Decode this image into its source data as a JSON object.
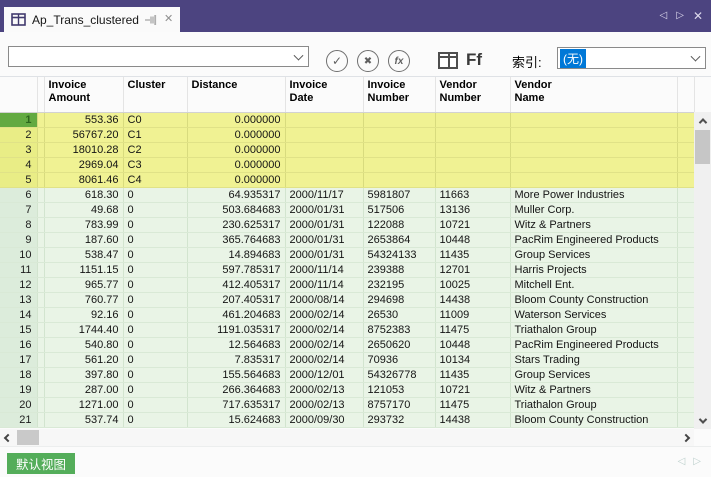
{
  "window": {
    "tab_title": "Ap_Trans_clustered",
    "nav_back": "◁",
    "nav_forward": "▷",
    "close": "✕"
  },
  "toolbar": {
    "filter_value": "",
    "apply_glyph": "✓",
    "cancel_glyph": "✖",
    "fx_glyph": "fx",
    "font_button": "Ff",
    "index_label": "索引:",
    "index_selected": "(无)"
  },
  "table": {
    "columns": [
      {
        "id": "invoice_amount",
        "lines": [
          "Invoice",
          "Amount"
        ],
        "align": "right"
      },
      {
        "id": "cluster",
        "lines": [
          "Cluster"
        ],
        "align": "left"
      },
      {
        "id": "distance",
        "lines": [
          "Distance"
        ],
        "align": "right"
      },
      {
        "id": "invoice_date",
        "lines": [
          "Invoice",
          "Date"
        ],
        "align": "left"
      },
      {
        "id": "invoice_number",
        "lines": [
          "Invoice",
          "Number"
        ],
        "align": "left"
      },
      {
        "id": "vendor_number",
        "lines": [
          "Vendor",
          "Number"
        ],
        "align": "left"
      },
      {
        "id": "vendor_name",
        "lines": [
          "Vendor",
          "Name"
        ],
        "align": "left"
      }
    ],
    "rows": [
      {
        "num": 1,
        "highlight": true,
        "cells": {
          "invoice_amount": "553.36",
          "cluster": "C0",
          "distance": "0.000000",
          "invoice_date": "",
          "invoice_number": "",
          "vendor_number": "",
          "vendor_name": ""
        }
      },
      {
        "num": 2,
        "highlight": true,
        "cells": {
          "invoice_amount": "56767.20",
          "cluster": "C1",
          "distance": "0.000000",
          "invoice_date": "",
          "invoice_number": "",
          "vendor_number": "",
          "vendor_name": ""
        }
      },
      {
        "num": 3,
        "highlight": true,
        "cells": {
          "invoice_amount": "18010.28",
          "cluster": "C2",
          "distance": "0.000000",
          "invoice_date": "",
          "invoice_number": "",
          "vendor_number": "",
          "vendor_name": ""
        }
      },
      {
        "num": 4,
        "highlight": true,
        "cells": {
          "invoice_amount": "2969.04",
          "cluster": "C3",
          "distance": "0.000000",
          "invoice_date": "",
          "invoice_number": "",
          "vendor_number": "",
          "vendor_name": ""
        }
      },
      {
        "num": 5,
        "highlight": true,
        "cells": {
          "invoice_amount": "8061.46",
          "cluster": "C4",
          "distance": "0.000000",
          "invoice_date": "",
          "invoice_number": "",
          "vendor_number": "",
          "vendor_name": ""
        }
      },
      {
        "num": 6,
        "highlight": false,
        "cells": {
          "invoice_amount": "618.30",
          "cluster": "0",
          "distance": "64.935317",
          "invoice_date": "2000/11/17",
          "invoice_number": "5981807",
          "vendor_number": "11663",
          "vendor_name": "More Power Industries"
        }
      },
      {
        "num": 7,
        "highlight": false,
        "cells": {
          "invoice_amount": "49.68",
          "cluster": "0",
          "distance": "503.684683",
          "invoice_date": "2000/01/31",
          "invoice_number": "517506",
          "vendor_number": "13136",
          "vendor_name": "Muller Corp."
        }
      },
      {
        "num": 8,
        "highlight": false,
        "cells": {
          "invoice_amount": "783.99",
          "cluster": "0",
          "distance": "230.625317",
          "invoice_date": "2000/01/31",
          "invoice_number": "122088",
          "vendor_number": "10721",
          "vendor_name": "Witz & Partners"
        }
      },
      {
        "num": 9,
        "highlight": false,
        "cells": {
          "invoice_amount": "187.60",
          "cluster": "0",
          "distance": "365.764683",
          "invoice_date": "2000/01/31",
          "invoice_number": "2653864",
          "vendor_number": "10448",
          "vendor_name": "PacRim Engineered Products"
        }
      },
      {
        "num": 10,
        "highlight": false,
        "cells": {
          "invoice_amount": "538.47",
          "cluster": "0",
          "distance": "14.894683",
          "invoice_date": "2000/01/31",
          "invoice_number": "54324133",
          "vendor_number": "11435",
          "vendor_name": "Group Services"
        }
      },
      {
        "num": 11,
        "highlight": false,
        "cells": {
          "invoice_amount": "1151.15",
          "cluster": "0",
          "distance": "597.785317",
          "invoice_date": "2000/11/14",
          "invoice_number": "239388",
          "vendor_number": "12701",
          "vendor_name": "Harris Projects"
        }
      },
      {
        "num": 12,
        "highlight": false,
        "cells": {
          "invoice_amount": "965.77",
          "cluster": "0",
          "distance": "412.405317",
          "invoice_date": "2000/11/14",
          "invoice_number": "232195",
          "vendor_number": "10025",
          "vendor_name": "Mitchell Ent."
        }
      },
      {
        "num": 13,
        "highlight": false,
        "cells": {
          "invoice_amount": "760.77",
          "cluster": "0",
          "distance": "207.405317",
          "invoice_date": "2000/08/14",
          "invoice_number": "294698",
          "vendor_number": "14438",
          "vendor_name": "Bloom County Construction"
        }
      },
      {
        "num": 14,
        "highlight": false,
        "cells": {
          "invoice_amount": "92.16",
          "cluster": "0",
          "distance": "461.204683",
          "invoice_date": "2000/02/14",
          "invoice_number": "26530",
          "vendor_number": "11009",
          "vendor_name": "Waterson Services"
        }
      },
      {
        "num": 15,
        "highlight": false,
        "cells": {
          "invoice_amount": "1744.40",
          "cluster": "0",
          "distance": "1191.035317",
          "invoice_date": "2000/02/14",
          "invoice_number": "8752383",
          "vendor_number": "11475",
          "vendor_name": "Triathalon Group"
        }
      },
      {
        "num": 16,
        "highlight": false,
        "cells": {
          "invoice_amount": "540.80",
          "cluster": "0",
          "distance": "12.564683",
          "invoice_date": "2000/02/14",
          "invoice_number": "2650620",
          "vendor_number": "10448",
          "vendor_name": "PacRim Engineered Products"
        }
      },
      {
        "num": 17,
        "highlight": false,
        "cells": {
          "invoice_amount": "561.20",
          "cluster": "0",
          "distance": "7.835317",
          "invoice_date": "2000/02/14",
          "invoice_number": "70936",
          "vendor_number": "10134",
          "vendor_name": "Stars Trading"
        }
      },
      {
        "num": 18,
        "highlight": false,
        "cells": {
          "invoice_amount": "397.80",
          "cluster": "0",
          "distance": "155.564683",
          "invoice_date": "2000/12/01",
          "invoice_number": "54326778",
          "vendor_number": "11435",
          "vendor_name": "Group Services"
        }
      },
      {
        "num": 19,
        "highlight": false,
        "cells": {
          "invoice_amount": "287.00",
          "cluster": "0",
          "distance": "266.364683",
          "invoice_date": "2000/02/13",
          "invoice_number": "121053",
          "vendor_number": "10721",
          "vendor_name": "Witz & Partners"
        }
      },
      {
        "num": 20,
        "highlight": false,
        "cells": {
          "invoice_amount": "1271.00",
          "cluster": "0",
          "distance": "717.635317",
          "invoice_date": "2000/02/13",
          "invoice_number": "8757170",
          "vendor_number": "11475",
          "vendor_name": "Triathalon Group"
        }
      },
      {
        "num": 21,
        "highlight": false,
        "cells": {
          "invoice_amount": "537.74",
          "cluster": "0",
          "distance": "15.624683",
          "invoice_date": "2000/09/30",
          "invoice_number": "293732",
          "vendor_number": "14438",
          "vendor_name": "Bloom County Construction"
        }
      }
    ]
  },
  "statusbar": {
    "view_tab": "默认视图"
  },
  "colors": {
    "tabbar_purple": "#4c4480",
    "highlight_yellow": "#f0f293",
    "row_green": "#e9f4e6",
    "selected_record_green": "#63aa41",
    "selection_blue": "#0078d7",
    "view_tab_green": "#54ad5a"
  }
}
